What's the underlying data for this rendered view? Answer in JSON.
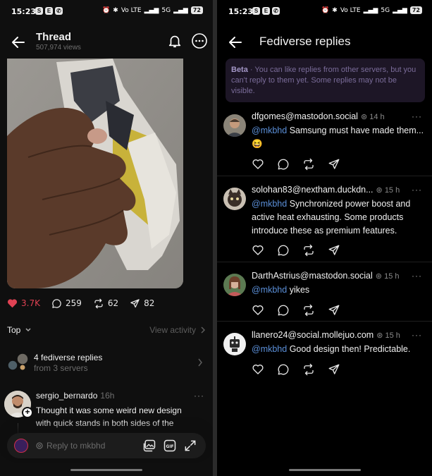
{
  "status_bar": {
    "time": "15:23",
    "app_icons": [
      "S",
      "E",
      "W"
    ],
    "network_label_1": "Vo LTE",
    "network_label_2": "5G",
    "battery": "72"
  },
  "thread": {
    "title": "Thread",
    "views": "507,974 views",
    "stats": {
      "likes": "3.7K",
      "replies": "259",
      "reposts": "62",
      "shares": "82"
    },
    "sort_label": "Top",
    "view_activity": "View activity",
    "fediverse": {
      "title": "4 fediverse replies",
      "subtitle": "from 3 servers"
    },
    "reply": {
      "username": "sergio_bernardo",
      "time": "16h",
      "text": "Thought it was some weird new design with quick stands in both sides of the"
    },
    "composer": {
      "placeholder": "Reply to mkbhd"
    }
  },
  "fediverse_replies": {
    "title": "Fediverse replies",
    "beta": {
      "badge": "Beta",
      "text": "You can like replies from other servers, but you can't reply to them yet. Some replies may not be visible."
    },
    "replies": [
      {
        "handle": "dfgomes@mastodon.social",
        "time": "14 h",
        "mention": "@mkbhd",
        "text": "Samsung must have made them...",
        "emoji": "😆"
      },
      {
        "handle": "solohan83@nextham.duckdn...",
        "time": "15 h",
        "mention": "@mkbhd",
        "text": "Synchronized power boost and active heat exhausting. Some products introduce these as premium features."
      },
      {
        "handle": "DarthAstrius@mastodon.social",
        "time": "15 h",
        "mention": "@mkbhd",
        "text": "yikes"
      },
      {
        "handle": "llanero24@social.mollejuo.com",
        "time": "15 h",
        "mention": "@mkbhd",
        "text": "Good design then! Predictable."
      }
    ]
  },
  "colors": {
    "like_red": "#e04253",
    "mention_blue": "#5b8fd8",
    "beta_bg": "#1d1626"
  }
}
